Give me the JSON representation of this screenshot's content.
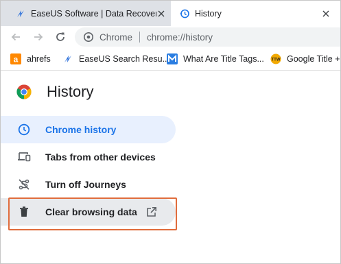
{
  "tabs": [
    {
      "title": "EaseUS Software | Data Recovery",
      "icon": "easeus-icon",
      "active": false
    },
    {
      "title": "History",
      "icon": "history-icon",
      "active": true
    }
  ],
  "omnibox": {
    "secure_label": "Chrome",
    "url": "chrome://history"
  },
  "bookmarks": [
    {
      "label": "ahrefs",
      "icon": "ahrefs-icon"
    },
    {
      "label": "EaseUS Search Resu...",
      "icon": "easeus-icon"
    },
    {
      "label": "What Are Title Tags...",
      "icon": "moz-icon"
    },
    {
      "label": "Google Title +",
      "icon": "ttw-icon"
    }
  ],
  "page": {
    "title": "History"
  },
  "sidebar": {
    "items": [
      {
        "label": "Chrome history",
        "icon": "clock-icon",
        "selected": true
      },
      {
        "label": "Tabs from other devices",
        "icon": "devices-icon",
        "selected": false
      },
      {
        "label": "Turn off Journeys",
        "icon": "journeys-off-icon",
        "selected": false
      },
      {
        "label": "Clear browsing data",
        "icon": "trash-icon",
        "selected": false,
        "highlighted": true
      }
    ]
  },
  "colors": {
    "accent": "#1a73e8",
    "highlight_border": "#e06c3c",
    "tabstrip": "#dee1e6"
  }
}
